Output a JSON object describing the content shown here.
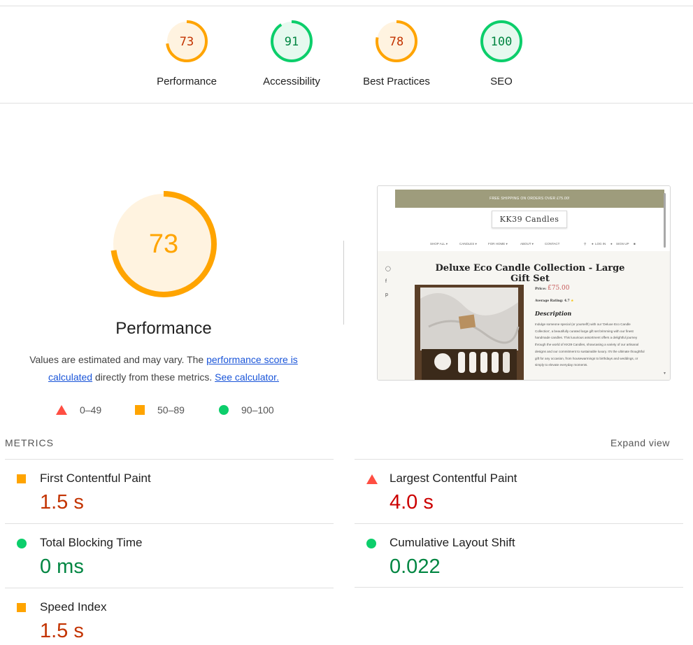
{
  "colors": {
    "pass": "#0cce6b",
    "average": "#ffa400",
    "fail": "#ff4e42",
    "average_text": "#c33300",
    "pass_text": "#018642",
    "fail_text": "#cc0000"
  },
  "scores": [
    {
      "value": 73,
      "label": "Performance",
      "level": "average"
    },
    {
      "value": 91,
      "label": "Accessibility",
      "level": "pass"
    },
    {
      "value": 78,
      "label": "Best Practices",
      "level": "average"
    },
    {
      "value": 100,
      "label": "SEO",
      "level": "pass"
    }
  ],
  "performance": {
    "score": 73,
    "title": "Performance",
    "desc_prefix": "Values are estimated and may vary. The ",
    "desc_link1": "performance score is calculated",
    "desc_middle": " directly from these metrics.",
    "desc_link2": "See calculator."
  },
  "legend": [
    {
      "range": "0–49",
      "shape": "triangle-icon"
    },
    {
      "range": "50–89",
      "shape": "square-icon"
    },
    {
      "range": "90–100",
      "shape": "circle-icon"
    }
  ],
  "screenshot": {
    "banner": "FREE SHIPPING ON ORDERS OVER £75.00!",
    "logo": "KK39 Candles",
    "nav": [
      "SHOP ALL ▾",
      "CANDLES ▾",
      "FOR HOME ▾",
      "ABOUT ▾",
      "CONTACT"
    ],
    "account": [
      "LOG IN",
      "SIGN UP"
    ],
    "title": "Deluxe Eco Candle Collection - Large Gift Set",
    "price_label": "Price:",
    "price": "£75.00",
    "rating": "Average Rating: 4.7",
    "desc_title": "Description",
    "desc": "Indulge someone special (or yourself!) with our 'Deluxe Eco Candle Collection', a beautifully curated large gift set brimming with our finest handmade candles. This luxurious assortment offers a delightful journey through the world of KK39 Candles, showcasing a variety of our artisanal designs and our commitment to sustainable luxury. It's the ultimate thoughtful gift for any occasion, from housewarmings to birthdays and weddings, or simply to elevate everyday moments."
  },
  "metrics": {
    "heading": "METRICS",
    "expand": "Expand view",
    "items": [
      {
        "label": "First Contentful Paint",
        "value": "1.5 s",
        "level": "average"
      },
      {
        "label": "Largest Contentful Paint",
        "value": "4.0 s",
        "level": "fail"
      },
      {
        "label": "Total Blocking Time",
        "value": "0 ms",
        "level": "pass"
      },
      {
        "label": "Cumulative Layout Shift",
        "value": "0.022",
        "level": "pass"
      },
      {
        "label": "Speed Index",
        "value": "1.5 s",
        "level": "average"
      }
    ]
  }
}
